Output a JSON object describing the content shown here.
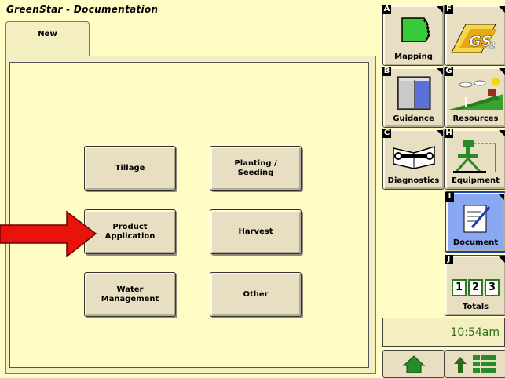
{
  "window": {
    "title": "GreenStar - Documentation"
  },
  "tabs": [
    {
      "label": "New"
    }
  ],
  "buttons": {
    "tillage": "Tillage",
    "planting": "Planting /\nSeeding",
    "product": "Product\nApplication",
    "harvest": "Harvest",
    "water": "Water\nManagement",
    "other": "Other"
  },
  "softkeys": {
    "a": {
      "letter": "A",
      "label": "Mapping"
    },
    "f": {
      "letter": "F",
      "label": ""
    },
    "b": {
      "letter": "B",
      "label": "Guidance"
    },
    "g": {
      "letter": "G",
      "label": "Resources"
    },
    "c": {
      "letter": "C",
      "label": "Diagnostics"
    },
    "h": {
      "letter": "H",
      "label": "Equipment"
    },
    "i": {
      "letter": "I",
      "label": "Document"
    },
    "j": {
      "letter": "J",
      "label": "Totals",
      "digits": [
        "1",
        "2",
        "3"
      ]
    }
  },
  "clock": "10:54am",
  "colors": {
    "background": "#fffdc3",
    "active_key": "#8aa8f2",
    "clock_text": "#2d6e1a",
    "arrow": "#e8140c"
  }
}
